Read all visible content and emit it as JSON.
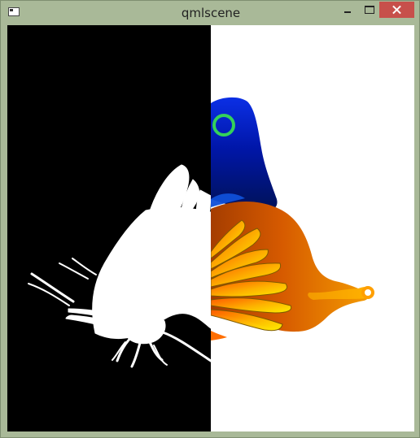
{
  "window": {
    "title": "qmlscene",
    "background_color": "#a9b998",
    "close_color": "#c7504b"
  },
  "titlebar": {
    "icon": "app-window-icon",
    "minimize_icon": "minimize-icon",
    "maximize_icon": "maximize-icon",
    "close_icon": "close-icon"
  },
  "scene": {
    "left_background": "#000000",
    "right_background": "#ffffff",
    "subject": "butterfly-icon",
    "left_style": "white silhouette",
    "right_style": "gradient color rendering",
    "accent_colors": [
      "#0016a8",
      "#ff7a00",
      "#ffe600",
      "#34d15a"
    ]
  }
}
